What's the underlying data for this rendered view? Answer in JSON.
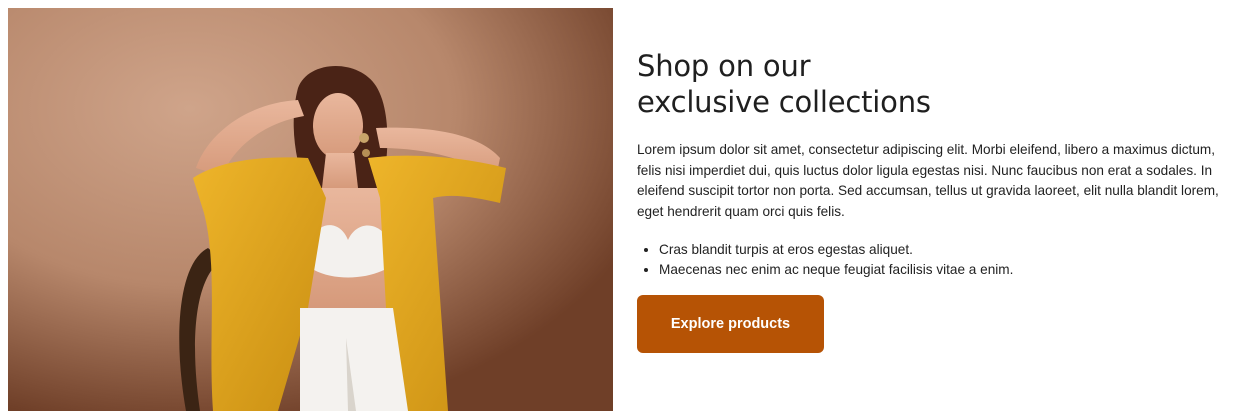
{
  "hero": {
    "image_name": "fashion-model-yellow-blazer-photo"
  },
  "content": {
    "title_line1": "Shop on our",
    "title_line2": "exclusive collections",
    "description": "Lorem ipsum dolor sit amet, consectetur adipiscing elit. Morbi eleifend, libero a maximus dictum, felis nisi imperdiet dui, quis luctus dolor ligula egestas nisi. Nunc faucibus non erat a sodales. In eleifend suscipit tortor non porta. Sed accumsan, tellus ut gravida laoreet, elit nulla blandit lorem, eget hendrerit quam orci quis felis.",
    "bullets": [
      "Cras blandit turpis at eros egestas aliquet.",
      "Maecenas nec enim ac neque feugiat facilisis vitae a enim."
    ],
    "cta_label": "Explore products"
  },
  "colors": {
    "cta_background": "#b65305",
    "cta_text": "#ffffff",
    "backdrop": "#c69a80",
    "blazer": "#e0a81c"
  }
}
